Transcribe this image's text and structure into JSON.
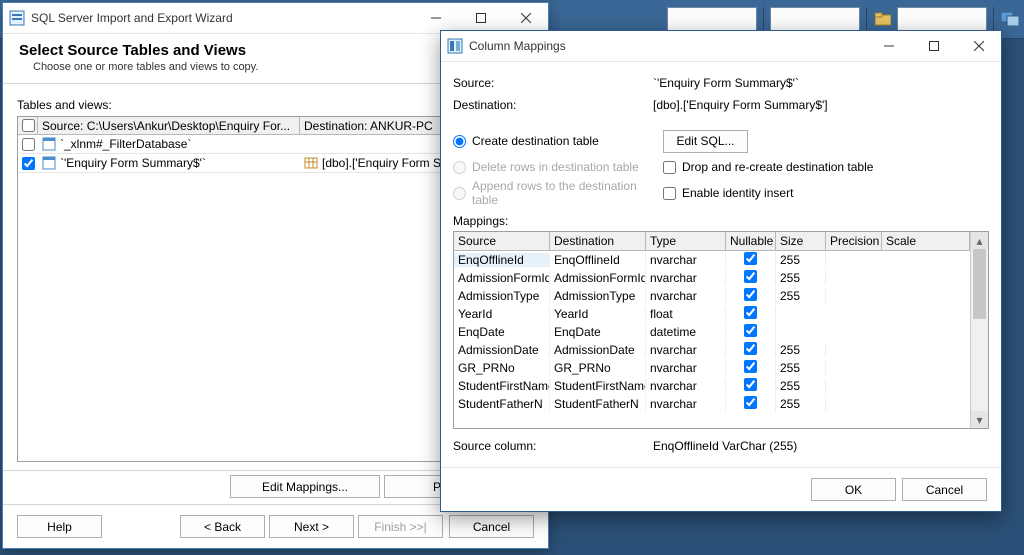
{
  "ribbon": {
    "icon1": "folder-icon",
    "icon2": "window-icon"
  },
  "wizard": {
    "title": "SQL Server Import and Export Wizard",
    "heading": "Select Source Tables and Views",
    "subheading": "Choose one or more tables and views to copy.",
    "tables_label": "Tables and views:",
    "headers": {
      "source": "Source: C:\\Users\\Ankur\\Desktop\\Enquiry For...",
      "destination": "Destination: ANKUR-PC"
    },
    "rows": [
      {
        "checked": false,
        "source": "`_xlnm#_FilterDatabase`",
        "destination": ""
      },
      {
        "checked": true,
        "source": "`'Enquiry Form Summary$'`",
        "destination": "[dbo].['Enquiry Form Summary$']"
      }
    ],
    "buttons": {
      "edit_mappings": "Edit Mappings...",
      "preview": "Preview...",
      "help": "Help",
      "back": "< Back",
      "next": "Next >",
      "finish": "Finish >>|",
      "cancel": "Cancel"
    }
  },
  "dialog": {
    "title": "Column Mappings",
    "source_label": "Source:",
    "source_value": "`'Enquiry Form Summary$'`",
    "dest_label": "Destination:",
    "dest_value": "[dbo].['Enquiry Form Summary$']",
    "opt_create": "Create destination table",
    "opt_delete": "Delete rows in destination table",
    "opt_append": "Append rows to the destination table",
    "opt_drop": "Drop and re-create destination table",
    "opt_identity": "Enable identity insert",
    "edit_sql": "Edit SQL...",
    "mappings_label": "Mappings:",
    "columns": {
      "c1": "Source",
      "c2": "Destination",
      "c3": "Type",
      "c4": "Nullable",
      "c5": "Size",
      "c6": "Precision",
      "c7": "Scale"
    },
    "rows": [
      {
        "s": "EnqOfflineId",
        "d": "EnqOfflineId",
        "t": "nvarchar",
        "n": true,
        "sz": "255"
      },
      {
        "s": "AdmissionFormId",
        "d": "AdmissionFormId",
        "t": "nvarchar",
        "n": true,
        "sz": "255"
      },
      {
        "s": "AdmissionType",
        "d": "AdmissionType",
        "t": "nvarchar",
        "n": true,
        "sz": "255"
      },
      {
        "s": "YearId",
        "d": "YearId",
        "t": "float",
        "n": true,
        "sz": ""
      },
      {
        "s": "EnqDate",
        "d": "EnqDate",
        "t": "datetime",
        "n": true,
        "sz": ""
      },
      {
        "s": "AdmissionDate",
        "d": "AdmissionDate",
        "t": "nvarchar",
        "n": true,
        "sz": "255"
      },
      {
        "s": "GR_PRNo",
        "d": "GR_PRNo",
        "t": "nvarchar",
        "n": true,
        "sz": "255"
      },
      {
        "s": "StudentFirstName",
        "d": "StudentFirstName",
        "t": "nvarchar",
        "n": true,
        "sz": "255"
      },
      {
        "s": "StudentFatherN",
        "d": "StudentFatherN",
        "t": "nvarchar",
        "n": true,
        "sz": "255"
      }
    ],
    "source_col_label": "Source column:",
    "source_col_value": "EnqOfflineId VarChar (255)",
    "ok": "OK",
    "cancel": "Cancel"
  }
}
